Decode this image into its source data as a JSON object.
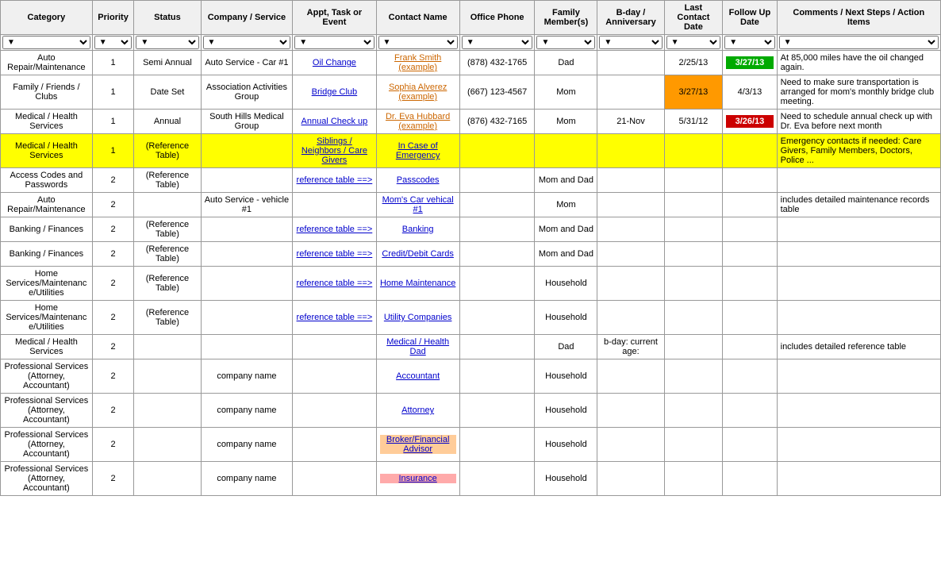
{
  "headers": {
    "category": "Category",
    "priority": "Priority",
    "status": "Status",
    "company": "Company / Service",
    "appt": "Appt, Task or Event",
    "contact": "Contact Name",
    "phone": "Office Phone",
    "family": "Family Member(s)",
    "bday": "B-day / Anniversary",
    "lastcontact": "Last Contact Date",
    "followup": "Follow Up Date",
    "comments": "Comments / Next Steps / Action Items"
  },
  "rows": [
    {
      "category": "Auto Repair/Maintenance",
      "priority": "1",
      "status": "Semi Annual",
      "company": "Auto Service - Car #1",
      "appt": "Oil Change",
      "appt_link": true,
      "contact": "Frank Smith (example)",
      "contact_style": "orange_link",
      "phone": "(878) 432-1765",
      "family": "Dad",
      "bday": "",
      "lastcontact": "2/25/13",
      "followup": "3/27/13",
      "followup_style": "green",
      "comments": "At 85,000 miles have the oil changed again."
    },
    {
      "category": "Family / Friends / Clubs",
      "priority": "1",
      "status": "Date Set",
      "company": "Association Activities Group",
      "appt": "Bridge Club",
      "appt_link": true,
      "contact": "Sophia Alverez (example)",
      "contact_style": "orange_link",
      "phone": "(667) 123-4567",
      "family": "Mom",
      "bday": "",
      "lastcontact": "3/27/13",
      "lastcontact_style": "orange",
      "followup": "4/3/13",
      "followup_style": "normal",
      "comments": "Need to make sure transportation is arranged for mom's monthly bridge club meeting."
    },
    {
      "category": "Medical / Health Services",
      "priority": "1",
      "status": "Annual",
      "company": "South Hills Medical Group",
      "appt": "Annual Check up",
      "appt_link": true,
      "contact": "Dr. Eva Hubbard (example)",
      "contact_style": "orange_link",
      "phone": "(876) 432-7165",
      "family": "Mom",
      "bday": "21-Nov",
      "lastcontact": "5/31/12",
      "followup": "3/26/13",
      "followup_style": "red",
      "comments": "Need to schedule annual check up with Dr. Eva before next month"
    },
    {
      "category": "Medical / Health Services",
      "priority": "1",
      "status": "(Reference Table)",
      "company": "",
      "appt": "Siblings / Neighbors / Care Givers",
      "appt_link": true,
      "contact": "In Case of Emergency",
      "contact_style": "blue_link",
      "phone": "",
      "family": "",
      "bday": "",
      "lastcontact": "",
      "followup": "",
      "followup_style": "normal",
      "comments": "Emergency contacts if needed: Care Givers, Family Members, Doctors, Police ...",
      "row_style": "yellow"
    },
    {
      "category": "Access Codes and Passwords",
      "priority": "2",
      "status": "(Reference Table)",
      "company": "",
      "appt": "reference table ==>",
      "appt_link": true,
      "contact": "Passcodes",
      "contact_style": "blue_link",
      "phone": "",
      "family": "Mom and Dad",
      "bday": "",
      "lastcontact": "",
      "followup": "",
      "followup_style": "normal",
      "comments": ""
    },
    {
      "category": "Auto Repair/Maintenance",
      "priority": "2",
      "status": "",
      "company": "Auto Service - vehicle #1",
      "appt": "",
      "appt_link": false,
      "contact": "Mom's Car vehical #1",
      "contact_style": "blue_link",
      "phone": "",
      "family": "Mom",
      "bday": "",
      "lastcontact": "",
      "followup": "",
      "followup_style": "normal",
      "comments": "includes detailed maintenance records table"
    },
    {
      "category": "Banking / Finances",
      "priority": "2",
      "status": "(Reference Table)",
      "company": "",
      "appt": "reference table ==>",
      "appt_link": true,
      "contact": "Banking",
      "contact_style": "blue_link",
      "phone": "",
      "family": "Mom and Dad",
      "bday": "",
      "lastcontact": "",
      "followup": "",
      "followup_style": "normal",
      "comments": ""
    },
    {
      "category": "Banking / Finances",
      "priority": "2",
      "status": "(Reference Table)",
      "company": "",
      "appt": "reference table ==>",
      "appt_link": true,
      "contact": "Credit/Debit Cards",
      "contact_style": "blue_link",
      "phone": "",
      "family": "Mom and Dad",
      "bday": "",
      "lastcontact": "",
      "followup": "",
      "followup_style": "normal",
      "comments": ""
    },
    {
      "category": "Home Services/Maintenance/Utilities",
      "priority": "2",
      "status": "(Reference Table)",
      "company": "",
      "appt": "reference table ==>",
      "appt_link": true,
      "contact": "Home Maintenance",
      "contact_style": "blue_link",
      "phone": "",
      "family": "Household",
      "bday": "",
      "lastcontact": "",
      "followup": "",
      "followup_style": "normal",
      "comments": ""
    },
    {
      "category": "Home Services/Maintenance/Utilities",
      "priority": "2",
      "status": "(Reference Table)",
      "company": "",
      "appt": "reference table ==>",
      "appt_link": true,
      "contact": "Utility Companies",
      "contact_style": "blue_link",
      "phone": "",
      "family": "Household",
      "bday": "",
      "lastcontact": "",
      "followup": "",
      "followup_style": "normal",
      "comments": ""
    },
    {
      "category": "Medical / Health Services",
      "priority": "2",
      "status": "",
      "company": "",
      "appt": "",
      "appt_link": false,
      "contact": "Medical / Health Dad",
      "contact_style": "blue_link",
      "phone": "",
      "family": "Dad",
      "bday": "b-day: current age:",
      "lastcontact": "",
      "followup": "",
      "followup_style": "normal",
      "comments": "includes detailed reference table"
    },
    {
      "category": "Professional Services (Attorney, Accountant)",
      "priority": "2",
      "status": "",
      "company": "company name",
      "appt": "",
      "appt_link": false,
      "contact": "Accountant",
      "contact_style": "blue_link",
      "phone": "",
      "family": "Household",
      "bday": "",
      "lastcontact": "",
      "followup": "",
      "followup_style": "normal",
      "comments": ""
    },
    {
      "category": "Professional Services (Attorney, Accountant)",
      "priority": "2",
      "status": "",
      "company": "company name",
      "appt": "",
      "appt_link": false,
      "contact": "Attorney",
      "contact_style": "blue_link",
      "phone": "",
      "family": "Household",
      "bday": "",
      "lastcontact": "",
      "followup": "",
      "followup_style": "normal",
      "comments": ""
    },
    {
      "category": "Professional Services (Attorney, Accountant)",
      "priority": "2",
      "status": "",
      "company": "company name",
      "appt": "",
      "appt_link": false,
      "contact": "Broker/Financial Advisor",
      "contact_style": "light_orange_link",
      "phone": "",
      "family": "Household",
      "bday": "",
      "lastcontact": "",
      "followup": "",
      "followup_style": "normal",
      "comments": ""
    },
    {
      "category": "Professional Services (Attorney, Accountant)",
      "priority": "2",
      "status": "",
      "company": "company name",
      "appt": "",
      "appt_link": false,
      "contact": "Insurance",
      "contact_style": "pink_link",
      "phone": "",
      "family": "Household",
      "bday": "",
      "lastcontact": "",
      "followup": "",
      "followup_style": "normal",
      "comments": ""
    }
  ]
}
